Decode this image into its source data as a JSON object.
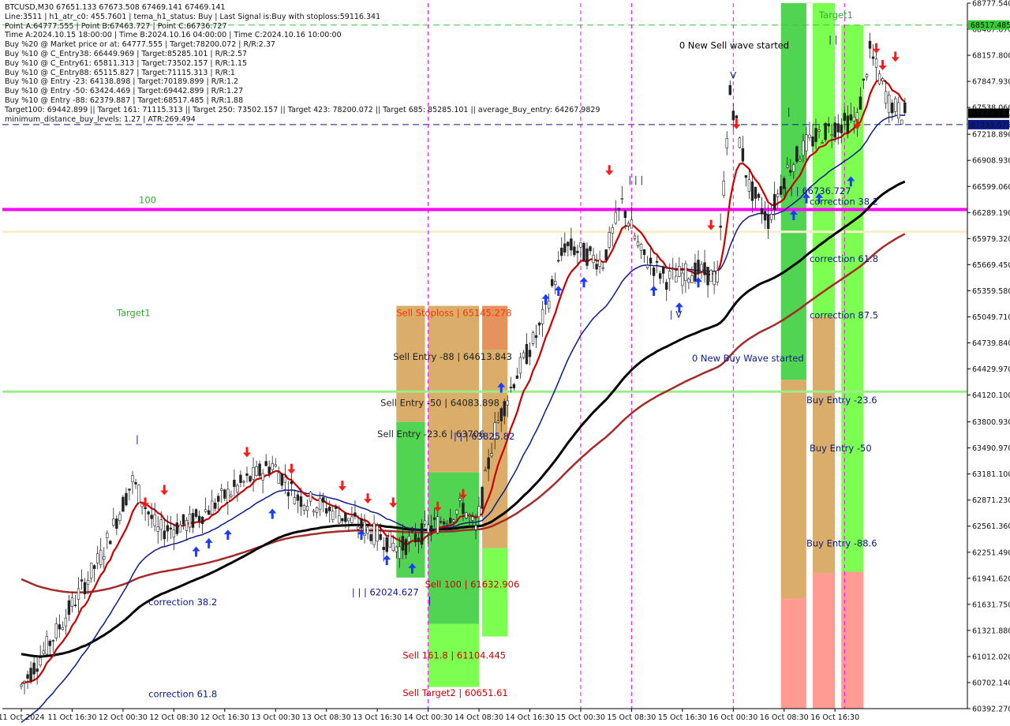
{
  "info_lines": [
    "BTCUSD,M30  67651.133 67673.508 67469.141 67469.141",
    "Line:3511 | h1_atr_c0: 455.7601 | tema_h1_status: Buy | Last Signal is:Buy with stoploss:59116.341",
    "Point A:64777.555 | Point B:67463.727 | Point C:66736.727",
    "Time A:2024.10.15 18:00:00 | Time B:2024.10.16 04:00:00 | Time C:2024.10.16 10:00:00",
    "Buy %20 @ Market price or at: 64777.555 | Target:78200.072 | R/R:2.37",
    "Buy %10 @ C_Entry38: 66449.969 | Target:85285.101 | R/R:2.57",
    "Buy %10 @ C_Entry61: 65811.313 | Target:73502.157 | R/R:1.15",
    "Buy %10 @ C_Entry88: 65115.827 | Target:71115.313 | R/R:1",
    "Buy %10 @ Entry -23: 64138.898 | Target:70189.899 | R/R:1.2",
    "Buy %10 @ Entry -50: 63424.469 | Target:69442.899 | R/R:1.27",
    "Buy %10 @ Entry -88: 62379.887 | Target:68517.485 | R/R:1.88",
    "Target100: 69442.899 || Target 161: 71115.313 || Target 250: 73502.157 || Target 423: 78200.072 || Target 685: 85285.101 || average_Buy_entry: 64267.9829",
    "minimum_distance_buy_levels: 1.27 | ATR:269.494"
  ],
  "colors": {
    "bg": "#ffffff",
    "magenta": "#ff00ff",
    "lime": "#66ff33",
    "green": "#33cc33",
    "orange": "#d4a050",
    "salmon": "#ff8a80",
    "red": "#cc0000",
    "navy": "#0a1a8c",
    "black": "#000000",
    "brown": "#a52a2a",
    "blue_arrow": "#1a3cff",
    "red_arrow": "#ff1a1a"
  },
  "chart_data": {
    "type": "candlestick",
    "symbol": "BTCUSD",
    "timeframe": "M30",
    "ylim": [
      60392.27,
      68777.54
    ],
    "y_ticks": [
      68777.54,
      68467.67,
      68157.8,
      67847.93,
      67538.06,
      67218.89,
      66908.93,
      66599.06,
      66289.19,
      65979.32,
      65669.45,
      65359.58,
      65049.71,
      64739.84,
      64429.97,
      64120.1,
      63800.93,
      63490.97,
      63181.1,
      62871.23,
      62561.36,
      62251.49,
      61941.62,
      61631.75,
      61321.88,
      61012.02,
      60702.14,
      60392.27
    ],
    "x_ticks": [
      "11 Oct 2024",
      "11 Oct 16:30",
      "12 Oct 00:30",
      "12 Oct 08:30",
      "12 Oct 16:30",
      "13 Oct 00:30",
      "13 Oct 08:30",
      "13 Oct 16:30",
      "14 Oct 00:30",
      "14 Oct 08:30",
      "14 Oct 16:30",
      "15 Oct 00:30",
      "15 Oct 08:30",
      "15 Oct 16:30",
      "16 Oct 00:30",
      "16 Oct 08:30",
      "16 Oct 16:30"
    ],
    "last_price": 67469.141,
    "price_labels": [
      {
        "value": 68517.485,
        "text": "68517.485",
        "bg": "#33cc33"
      },
      {
        "value": 67469.141,
        "text": "67469.141",
        "bg": "#000000"
      },
      {
        "value": 67333.875,
        "text": "67333.875",
        "bg": "#0a1a8c"
      }
    ],
    "horizontal_lines": [
      {
        "name": "level-100",
        "value": 66325,
        "color": "#ff00ff",
        "width": 4
      },
      {
        "name": "level-cream",
        "value": 66060,
        "color": "#f5f0c8",
        "width": 3
      },
      {
        "name": "level-green",
        "value": 64160,
        "color": "#99ee88",
        "width": 3
      },
      {
        "name": "avg-buy-entry",
        "value": 67333.875,
        "color": "#0a1a8c",
        "width": 1,
        "dash": true
      },
      {
        "name": "target-line",
        "value": 68517.485,
        "color": "#33cc33",
        "width": 1,
        "dash": true
      }
    ],
    "vertical_lines": [
      "13 Oct 16:30",
      "14 Oct 16:30",
      "15 Oct 00:30",
      "15 Oct 16:30",
      "16 Oct 10:00"
    ],
    "zones": [
      {
        "from": "13 Oct 11:30",
        "to": "13 Oct 16:00",
        "price_top": 65180,
        "price_bottom": 61950,
        "segments": [
          {
            "top": 65180,
            "bottom": 63800,
            "color": "#d4a050"
          },
          {
            "top": 63800,
            "bottom": 61950,
            "color": "#33cc33"
          }
        ]
      },
      {
        "from": "13 Oct 16:30",
        "to": "14 Oct 00:30",
        "price_top": 65180,
        "price_bottom": 60650,
        "segments": [
          {
            "top": 65180,
            "bottom": 63200,
            "color": "#d4a050"
          },
          {
            "top": 63200,
            "bottom": 61400,
            "color": "#33cc33"
          },
          {
            "top": 61400,
            "bottom": 60650,
            "color": "#66ff33"
          }
        ]
      },
      {
        "from": "14 Oct 01:00",
        "to": "14 Oct 05:00",
        "price_top": 65180,
        "price_bottom": 61250,
        "segments": [
          {
            "top": 65180,
            "bottom": 64660,
            "color": "#e08040"
          },
          {
            "top": 64660,
            "bottom": 62300,
            "color": "#d4a050"
          },
          {
            "top": 62300,
            "bottom": 61250,
            "color": "#66ff33"
          }
        ]
      },
      {
        "from": "16 Oct 00:00",
        "to": "16 Oct 04:00",
        "price_top": 68777.54,
        "price_bottom": 60392.27,
        "segments": [
          {
            "top": 68777.54,
            "bottom": 64300,
            "color": "#33cc33"
          },
          {
            "top": 64300,
            "bottom": 61700,
            "color": "#d4a050"
          },
          {
            "top": 61700,
            "bottom": 60392.27,
            "color": "#ff8a80"
          }
        ]
      },
      {
        "from": "16 Oct 05:00",
        "to": "16 Oct 08:30",
        "price_top": 68777.54,
        "price_bottom": 60392.27,
        "segments": [
          {
            "top": 68777.54,
            "bottom": 65050,
            "color": "#66ff33"
          },
          {
            "top": 65050,
            "bottom": 62000,
            "color": "#d4a050"
          },
          {
            "top": 62000,
            "bottom": 60392.27,
            "color": "#ff8a80"
          }
        ]
      },
      {
        "from": "16 Oct 09:30",
        "to": "16 Oct 13:00",
        "price_top": 68517.485,
        "price_bottom": 60392.27,
        "segments": [
          {
            "top": 68517.485,
            "bottom": 62020,
            "color": "#66ff33"
          },
          {
            "top": 62020,
            "bottom": 60392.27,
            "color": "#ff8a80"
          }
        ]
      }
    ],
    "annotations": [
      {
        "text": "100",
        "time": "11 Oct 19:00",
        "price": 66400,
        "color": "#33aa33"
      },
      {
        "text": "Target1",
        "time": "11 Oct 15:30",
        "price": 65060,
        "color": "#33aa33"
      },
      {
        "text": "Target1",
        "time": "16 Oct 06:00",
        "price": 68600,
        "color": "#33aa33"
      },
      {
        "text": "0 New Sell wave started",
        "time": "15 Oct 08:00",
        "price": 68240,
        "color": "#000000"
      },
      {
        "text": "0 New Buy Wave started",
        "time": "15 Oct 10:00",
        "price": 64520,
        "color": "#0a1a8c"
      },
      {
        "text": "Sell Stoploss | 65145.278",
        "time": "13 Oct 11:30",
        "price": 65060,
        "color": "#ff3300"
      },
      {
        "text": "Sell Entry -88 | 64613.843",
        "time": "13 Oct 11:00",
        "price": 64540,
        "color": "#222222"
      },
      {
        "text": "Sell Entry -50 | 64083.898",
        "time": "13 Oct 09:00",
        "price": 63990,
        "color": "#222222"
      },
      {
        "text": "Sell Entry -23.6 | 63706",
        "time": "13 Oct 08:30",
        "price": 63620,
        "color": "#222222"
      },
      {
        "text": "| | | 63825.82",
        "time": "13 Oct 20:30",
        "price": 63590,
        "color": "#0a1a8c"
      },
      {
        "text": "Sell 100 | 61632.906",
        "time": "13 Oct 16:00",
        "price": 61830,
        "color": "#cc0000"
      },
      {
        "text": "Sell 161.8 | 61104.445",
        "time": "13 Oct 12:30",
        "price": 60990,
        "color": "#cc0000"
      },
      {
        "text": "Sell Target2 | 60651.61",
        "time": "13 Oct 12:30",
        "price": 60540,
        "color": "#cc0000"
      },
      {
        "text": "| | | 62024.627",
        "time": "13 Oct 04:30",
        "price": 61740,
        "color": "#0a1a8c"
      },
      {
        "text": "correction 38.2",
        "time": "11 Oct 20:30",
        "price": 61620,
        "color": "#0a1a8c"
      },
      {
        "text": "correction 61.8",
        "time": "11 Oct 20:30",
        "price": 60530,
        "color": "#0a1a8c"
      },
      {
        "text": "| | | 66736.727",
        "time": "16 Oct 00:30",
        "price": 66510,
        "color": "#0a1a8c"
      },
      {
        "text": "correction 38.2",
        "time": "16 Oct 04:30",
        "price": 66380,
        "color": "#0a1a8c"
      },
      {
        "text": "correction 61.8",
        "time": "16 Oct 04:30",
        "price": 65700,
        "color": "#0a1a8c"
      },
      {
        "text": "correction 87.5",
        "time": "16 Oct 04:30",
        "price": 65030,
        "color": "#0a1a8c"
      },
      {
        "text": "Buy Entry -23.6",
        "time": "16 Oct 04:00",
        "price": 64020,
        "color": "#0a1a8c"
      },
      {
        "text": "Buy Entry -50",
        "time": "16 Oct 04:30",
        "price": 63450,
        "color": "#0a1a8c"
      },
      {
        "text": "Buy Entry -88.6",
        "time": "16 Oct 04:00",
        "price": 62320,
        "color": "#0a1a8c"
      },
      {
        "text": "| | |",
        "time": "15 Oct 00:00",
        "price": 66640,
        "color": "#0a1a8c"
      },
      {
        "text": "| V",
        "time": "15 Oct 06:30",
        "price": 65040,
        "color": "#0a1a8c"
      },
      {
        "text": "V",
        "time": "15 Oct 16:00",
        "price": 67880,
        "color": "#0a1a8c"
      },
      {
        "text": "| |",
        "time": "16 Oct 07:30",
        "price": 68310,
        "color": "#0a1a8c"
      },
      {
        "text": "|",
        "time": "11 Oct 18:30",
        "price": 63560,
        "color": "#0a1a8c"
      },
      {
        "text": "|",
        "time": "13 Oct 16:30",
        "price": 61640,
        "color": "#0a1a8c"
      },
      {
        "text": "|",
        "time": "16 Oct 01:00",
        "price": 67450,
        "color": "#0a1a8c"
      }
    ]
  }
}
